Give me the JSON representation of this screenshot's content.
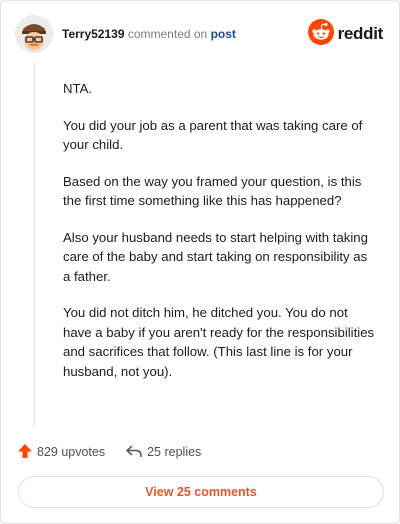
{
  "header": {
    "username": "Terry52139",
    "commented_on": "commented on",
    "post_link": "post",
    "logo_text": "reddit"
  },
  "comment": {
    "paragraphs": [
      "NTA.",
      "You did your job as a parent that was taking care of your child.",
      "Based on the way you framed your question, is this the first time something like this has happened?",
      "Also your husband needs to start helping with taking care of the baby and start taking on responsibility as a father.",
      "You did not ditch him, he ditched you. You do not have a baby if you aren't ready for the responsibilities and sacrifices that follow. (This last line is for your husband, not you)."
    ]
  },
  "actions": {
    "upvotes": "829 upvotes",
    "replies": "25 replies"
  },
  "footer": {
    "view_comments": "View 25 comments"
  },
  "colors": {
    "upvote": "#ff4500",
    "link": "#1a4e8c",
    "view_button_text": "#e0582b",
    "reddit_logo": "#ff4500"
  },
  "icons": {
    "avatar": "avatar",
    "logo": "reddit-logo-icon",
    "upvote": "upvote-arrow-icon",
    "reply": "reply-arrow-icon"
  }
}
